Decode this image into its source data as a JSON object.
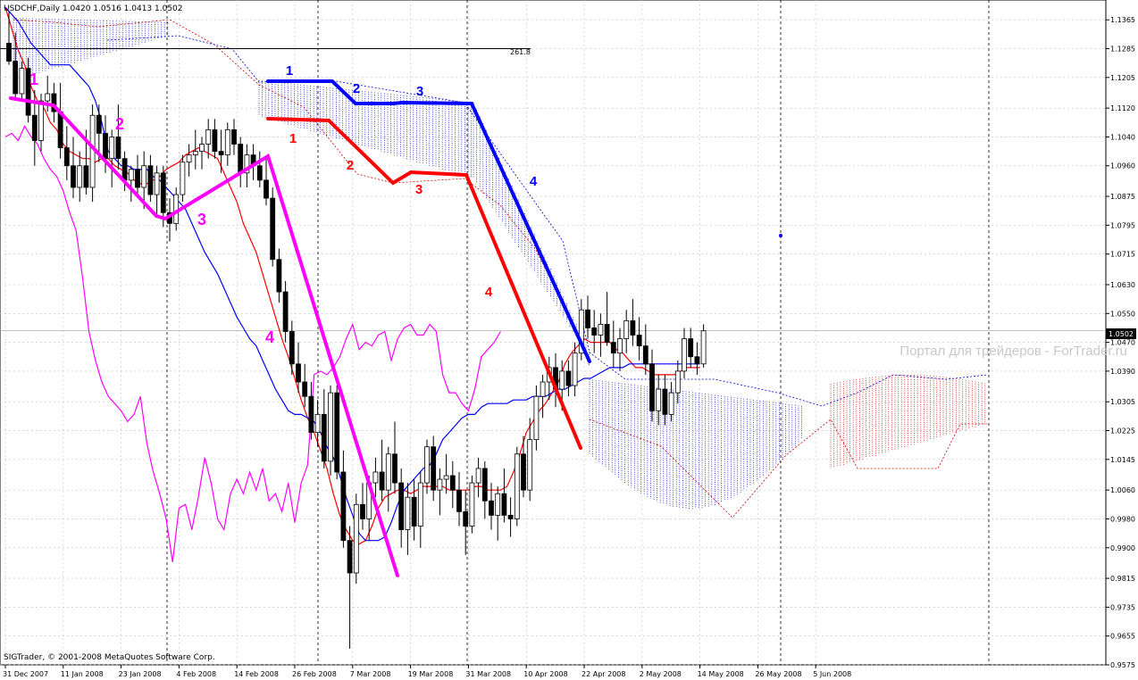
{
  "header": {
    "text": "USDCHF,Daily  1.0420 1.0516 1.0413 1.0502"
  },
  "watermark": "Портал для трейдеров - ForTrader.ru",
  "copyright": "SIGTrader, © 2001-2008 MetaQuotes Software Corp.",
  "fib_label": "261.8",
  "price_tag": "1.0502",
  "chart_data": {
    "type": "candlestick",
    "symbol": "USDCHF",
    "timeframe": "Daily",
    "header_values": {
      "open": 1.042,
      "high": 1.0516,
      "low": 1.0413,
      "close": 1.0502
    },
    "y_ticks": [
      "1.1365",
      "1.1285",
      "1.1205",
      "1.1120",
      "1.1040",
      "1.0960",
      "1.0875",
      "1.0795",
      "1.0715",
      "1.0630",
      "1.0550",
      "1.0470",
      "1.0390",
      "1.0305",
      "1.0225",
      "1.0145",
      "1.0060",
      "0.9980",
      "0.9900",
      "0.9815",
      "0.9735",
      "0.9655",
      "0.9575"
    ],
    "ylim": [
      0.9575,
      1.142
    ],
    "x_ticks": [
      "31 Dec 2007",
      "11 Jan 2008",
      "23 Jan 2008",
      "4 Feb 2008",
      "14 Feb 2008",
      "26 Feb 2008",
      "7 Mar 2008",
      "19 Mar 2008",
      "31 Mar 2008",
      "10 Apr 2008",
      "22 Apr 2008",
      "2 May 2008",
      "14 May 2008",
      "26 May 2008",
      "5 Jun 2008"
    ],
    "x_tick_bar_index": [
      0,
      9,
      18,
      27,
      36,
      45,
      54,
      63,
      72,
      81,
      90,
      99,
      108,
      117,
      126
    ],
    "current_price": 1.0502,
    "fib_level": {
      "label": "261.8",
      "price": 1.1285
    },
    "candles": [
      [
        1.13,
        1.139,
        1.124,
        1.125
      ],
      [
        1.125,
        1.133,
        1.114,
        1.116
      ],
      [
        1.116,
        1.125,
        1.114,
        1.123
      ],
      [
        1.123,
        1.126,
        1.108,
        1.11
      ],
      [
        1.11,
        1.117,
        1.096,
        1.103
      ],
      [
        1.103,
        1.116,
        1.1,
        1.114
      ],
      [
        1.114,
        1.121,
        1.111,
        1.116
      ],
      [
        1.116,
        1.119,
        1.108,
        1.111
      ],
      [
        1.111,
        1.119,
        1.098,
        1.101
      ],
      [
        1.101,
        1.107,
        1.092,
        1.096
      ],
      [
        1.096,
        1.104,
        1.087,
        1.09
      ],
      [
        1.09,
        1.1,
        1.086,
        1.096
      ],
      [
        1.096,
        1.106,
        1.088,
        1.09
      ],
      [
        1.09,
        1.113,
        1.086,
        1.11
      ],
      [
        1.11,
        1.113,
        1.097,
        1.105
      ],
      [
        1.105,
        1.11,
        1.094,
        1.098
      ],
      [
        1.098,
        1.106,
        1.09,
        1.104
      ],
      [
        1.104,
        1.113,
        1.095,
        1.098
      ],
      [
        1.098,
        1.1,
        1.089,
        1.092
      ],
      [
        1.092,
        1.096,
        1.086,
        1.095
      ],
      [
        1.095,
        1.099,
        1.088,
        1.09
      ],
      [
        1.09,
        1.1,
        1.084,
        1.096
      ],
      [
        1.096,
        1.099,
        1.086,
        1.088
      ],
      [
        1.088,
        1.096,
        1.082,
        1.094
      ],
      [
        1.094,
        1.096,
        1.079,
        1.083
      ],
      [
        1.083,
        1.087,
        1.075,
        1.08
      ],
      [
        1.08,
        1.09,
        1.078,
        1.088
      ],
      [
        1.088,
        1.099,
        1.086,
        1.097
      ],
      [
        1.097,
        1.102,
        1.093,
        1.099
      ],
      [
        1.099,
        1.106,
        1.095,
        1.1
      ],
      [
        1.1,
        1.104,
        1.095,
        1.102
      ],
      [
        1.102,
        1.109,
        1.098,
        1.106
      ],
      [
        1.106,
        1.109,
        1.098,
        1.1
      ],
      [
        1.1,
        1.106,
        1.094,
        1.099
      ],
      [
        1.099,
        1.108,
        1.096,
        1.106
      ],
      [
        1.106,
        1.109,
        1.099,
        1.102
      ],
      [
        1.102,
        1.104,
        1.09,
        1.094
      ],
      [
        1.094,
        1.102,
        1.09,
        1.099
      ],
      [
        1.099,
        1.102,
        1.092,
        1.096
      ],
      [
        1.096,
        1.1,
        1.09,
        1.092
      ],
      [
        1.092,
        1.098,
        1.085,
        1.087
      ],
      [
        1.087,
        1.09,
        1.068,
        1.07
      ],
      [
        1.07,
        1.073,
        1.058,
        1.061
      ],
      [
        1.061,
        1.064,
        1.047,
        1.05
      ],
      [
        1.05,
        1.053,
        1.038,
        1.041
      ],
      [
        1.041,
        1.047,
        1.033,
        1.036
      ],
      [
        1.036,
        1.041,
        1.029,
        1.032
      ],
      [
        1.032,
        1.036,
        1.02,
        1.022
      ],
      [
        1.022,
        1.031,
        1.018,
        1.027
      ],
      [
        1.027,
        1.034,
        1.012,
        1.014
      ],
      [
        1.014,
        1.035,
        1.01,
        1.033
      ],
      [
        1.033,
        1.035,
        1.009,
        1.011
      ],
      [
        1.011,
        1.017,
        0.99,
        0.992
      ],
      [
        0.992,
        0.996,
        0.962,
        0.983
      ],
      [
        0.983,
        1.005,
        0.98,
        1.002
      ],
      [
        1.002,
        1.008,
        0.995,
        0.998
      ],
      [
        0.998,
        1.01,
        0.992,
        1.008
      ],
      [
        1.008,
        1.015,
        1.004,
        1.011
      ],
      [
        1.011,
        1.02,
        1.003,
        1.006
      ],
      [
        1.006,
        1.018,
        1.0,
        1.016
      ],
      [
        1.016,
        1.025,
        1.005,
        1.008
      ],
      [
        1.008,
        1.012,
        0.99,
        0.995
      ],
      [
        0.995,
        1.008,
        0.988,
        1.004
      ],
      [
        1.004,
        1.009,
        0.992,
        0.996
      ],
      [
        0.996,
        1.011,
        0.99,
        1.008
      ],
      [
        1.008,
        1.02,
        1.005,
        1.018
      ],
      [
        1.018,
        1.021,
        1.003,
        1.006
      ],
      [
        1.006,
        1.012,
        0.999,
        1.009
      ],
      [
        1.009,
        1.016,
        1.005,
        1.01
      ],
      [
        1.01,
        1.014,
        1.001,
        1.006
      ],
      [
        1.006,
        1.011,
        0.996,
        1.0
      ],
      [
        1.0,
        1.006,
        0.988,
        0.996
      ],
      [
        0.996,
        1.01,
        0.994,
        1.008
      ],
      [
        1.008,
        1.015,
        1.004,
        1.012
      ],
      [
        1.012,
        1.014,
        0.998,
        1.003
      ],
      [
        1.003,
        1.008,
        0.995,
        0.999
      ],
      [
        0.999,
        1.007,
        0.992,
        1.005
      ],
      [
        1.005,
        1.012,
        0.997,
        0.999
      ],
      [
        0.999,
        1.004,
        0.993,
        0.998
      ],
      [
        0.998,
        1.018,
        0.996,
        1.016
      ],
      [
        1.016,
        1.021,
        1.004,
        1.006
      ],
      [
        1.006,
        1.026,
        1.003,
        1.02
      ],
      [
        1.02,
        1.035,
        1.017,
        1.032
      ],
      [
        1.032,
        1.038,
        1.026,
        1.036
      ],
      [
        1.036,
        1.043,
        1.031,
        1.04
      ],
      [
        1.04,
        1.044,
        1.029,
        1.034
      ],
      [
        1.034,
        1.042,
        1.028,
        1.039
      ],
      [
        1.039,
        1.042,
        1.032,
        1.035
      ],
      [
        1.035,
        1.047,
        1.032,
        1.044
      ],
      [
        1.044,
        1.059,
        1.042,
        1.056
      ],
      [
        1.056,
        1.06,
        1.048,
        1.051
      ],
      [
        1.051,
        1.056,
        1.044,
        1.049
      ],
      [
        1.049,
        1.055,
        1.043,
        1.052
      ],
      [
        1.052,
        1.061,
        1.046,
        1.047
      ],
      [
        1.047,
        1.053,
        1.04,
        1.044
      ],
      [
        1.044,
        1.051,
        1.039,
        1.048
      ],
      [
        1.048,
        1.056,
        1.044,
        1.053
      ],
      [
        1.053,
        1.059,
        1.046,
        1.049
      ],
      [
        1.049,
        1.054,
        1.042,
        1.046
      ],
      [
        1.046,
        1.052,
        1.038,
        1.041
      ],
      [
        1.041,
        1.045,
        1.025,
        1.028
      ],
      [
        1.028,
        1.038,
        1.024,
        1.034
      ],
      [
        1.034,
        1.038,
        1.024,
        1.027
      ],
      [
        1.027,
        1.036,
        1.025,
        1.033
      ],
      [
        1.033,
        1.042,
        1.03,
        1.039
      ],
      [
        1.039,
        1.051,
        1.037,
        1.048
      ],
      [
        1.048,
        1.051,
        1.04,
        1.043
      ],
      [
        1.043,
        1.047,
        1.038,
        1.041
      ],
      [
        1.041,
        1.052,
        1.04,
        1.0502
      ]
    ],
    "overlays": {
      "tenkan_red": {
        "color": "#ff0000",
        "y": [
          1.14,
          1.134,
          1.128,
          1.124,
          1.118,
          1.114,
          1.112,
          1.108,
          1.106,
          1.102,
          1.1,
          1.099,
          1.098,
          1.098,
          1.097,
          1.098,
          1.098,
          1.096,
          1.095,
          1.094,
          1.092,
          1.091,
          1.091,
          1.092,
          1.093,
          1.095,
          1.096,
          1.097,
          1.099,
          1.1,
          1.101,
          1.1,
          1.099,
          1.098,
          1.094,
          1.09,
          1.086,
          1.08,
          1.076,
          1.072,
          1.066,
          1.06,
          1.054,
          1.048,
          1.043,
          1.037,
          1.031,
          1.026,
          1.022,
          1.017,
          1.012,
          1.005,
          0.999,
          0.995,
          0.992,
          0.991,
          0.992,
          0.996,
          1.001,
          1.004,
          1.005,
          1.006,
          1.006,
          1.005,
          1.006,
          1.007,
          1.007,
          1.007,
          1.007,
          1.006,
          1.006,
          1.006,
          1.006,
          1.007,
          1.007,
          1.006,
          1.006,
          1.006,
          1.007,
          1.011,
          1.016,
          1.022,
          1.025,
          1.028,
          1.03,
          1.033,
          1.036,
          1.041,
          1.044,
          1.046,
          1.048,
          1.047,
          1.047,
          1.047,
          1.047,
          1.045,
          1.044,
          1.042,
          1.04,
          1.04,
          1.039,
          1.038,
          1.038,
          1.038,
          1.038,
          1.039,
          1.04,
          1.04,
          1.04
        ]
      },
      "kijun_blue": {
        "color": "#0000ff",
        "y": [
          1.14,
          1.138,
          1.136,
          1.133,
          1.13,
          1.128,
          1.126,
          1.124,
          1.124,
          1.124,
          1.124,
          1.122,
          1.12,
          1.118,
          1.114,
          1.108,
          1.1,
          1.098,
          1.096,
          1.096,
          1.095,
          1.095,
          1.095,
          1.093,
          1.092,
          1.09,
          1.088,
          1.086,
          1.084,
          1.08,
          1.076,
          1.072,
          1.069,
          1.066,
          1.062,
          1.058,
          1.054,
          1.051,
          1.048,
          1.046,
          1.042,
          1.038,
          1.034,
          1.031,
          1.028,
          1.027,
          1.027,
          1.026,
          1.025,
          1.022,
          1.018,
          1.015,
          1.01,
          1.004,
          0.999,
          0.994,
          0.992,
          0.992,
          0.992,
          0.993,
          0.997,
          1.002,
          1.006,
          1.008,
          1.01,
          1.012,
          1.013,
          1.016,
          1.02,
          1.022,
          1.024,
          1.026,
          1.027,
          1.027,
          1.029,
          1.03,
          1.03,
          1.03,
          1.03,
          1.031,
          1.031,
          1.031,
          1.032,
          1.032,
          1.032,
          1.033,
          1.034,
          1.034,
          1.035,
          1.036,
          1.037,
          1.037,
          1.038,
          1.039,
          1.04,
          1.04,
          1.04,
          1.041,
          1.041,
          1.041,
          1.041,
          1.041,
          1.041,
          1.041,
          1.041,
          1.041,
          1.041,
          1.041,
          1.041
        ]
      },
      "chikou_magenta": {
        "color": "#ff00ff",
        "y": [
          1.104,
          1.105,
          1.103,
          1.107,
          1.104,
          1.102,
          1.098,
          1.095,
          1.093,
          1.089,
          1.083,
          1.078,
          1.065,
          1.05,
          1.042,
          1.036,
          1.032,
          1.03,
          1.028,
          1.025,
          1.027,
          1.032,
          1.019,
          1.011,
          1.005,
          0.998,
          0.986,
          1.001,
          1.002,
          0.995,
          1.004,
          1.015,
          1.008,
          0.998,
          0.995,
          1.005,
          1.009,
          1.005,
          1.011,
          1.006,
          1.012,
          1.003,
          1.005,
          1.0,
          1.008,
          0.997,
          1.008,
          1.013,
          1.038,
          1.039,
          1.038,
          1.04,
          1.043,
          1.048,
          1.052,
          1.045,
          1.047,
          1.046,
          1.049,
          1.05,
          1.042,
          1.048,
          1.051,
          1.052,
          1.049,
          1.049,
          1.052,
          1.05,
          1.038,
          1.033,
          1.033,
          1.03,
          1.028,
          1.034,
          1.043,
          1.045,
          1.047,
          1.05
        ]
      }
    },
    "wave_annotations": [
      {
        "label": "1",
        "color": "#ff00ff"
      },
      {
        "label": "2",
        "color": "#ff00ff"
      },
      {
        "label": "3",
        "color": "#ff00ff"
      },
      {
        "label": "4",
        "color": "#ff00ff"
      },
      {
        "label": "1",
        "color": "#ff0000"
      },
      {
        "label": "2",
        "color": "#ff0000"
      },
      {
        "label": "3",
        "color": "#ff0000"
      },
      {
        "label": "4",
        "color": "#ff0000"
      },
      {
        "label": "1",
        "color": "#0000ff"
      },
      {
        "label": "2",
        "color": "#0000ff"
      },
      {
        "label": "3",
        "color": "#0000ff"
      },
      {
        "label": "4",
        "color": "#0000ff"
      }
    ],
    "grid": true
  }
}
